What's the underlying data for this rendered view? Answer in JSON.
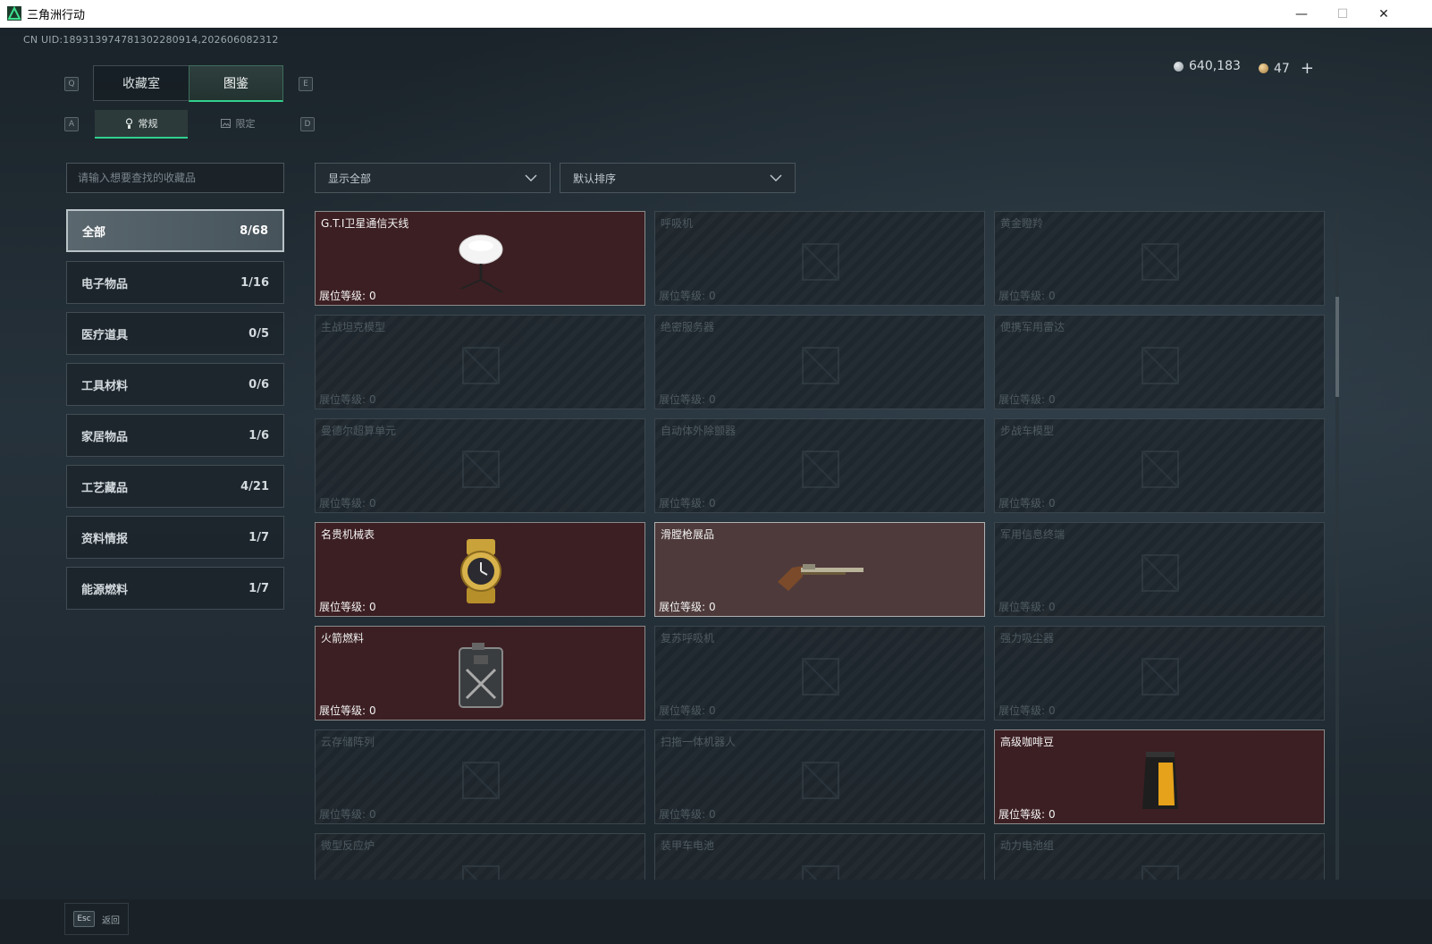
{
  "window": {
    "title": "三角洲行动",
    "minimize": "—",
    "maximize": "☐",
    "close": "✕"
  },
  "uid": "CN UID:189313974781302280914,202606082312",
  "currency": {
    "coins": "640,183",
    "gold": "47",
    "add": "+"
  },
  "tabs": [
    {
      "key": "Q"
    },
    {
      "label": "收藏室"
    },
    {
      "label": "图鉴"
    },
    {
      "key": "E"
    }
  ],
  "subtabs": {
    "left_key": "A",
    "right_key": "D",
    "items": [
      {
        "label": "常规"
      },
      {
        "label": "限定"
      }
    ]
  },
  "search": {
    "placeholder": "请输入想要查找的收藏品"
  },
  "filters": {
    "display": "显示全部",
    "sort": "默认排序"
  },
  "categories": [
    {
      "label": "全部",
      "count": "8/68"
    },
    {
      "label": "电子物品",
      "count": "1/16"
    },
    {
      "label": "医疗道具",
      "count": "0/5"
    },
    {
      "label": "工具材料",
      "count": "0/6"
    },
    {
      "label": "家居物品",
      "count": "1/6"
    },
    {
      "label": "工艺藏品",
      "count": "4/21"
    },
    {
      "label": "资料情报",
      "count": "1/7"
    },
    {
      "label": "能源燃料",
      "count": "1/7"
    }
  ],
  "level_label": "展位等级:",
  "items": [
    {
      "name": "G.T.I卫星通信天线",
      "level": "0",
      "owned": true,
      "icon": "satellite-antenna-icon"
    },
    {
      "name": "呼吸机",
      "level": "0",
      "owned": false,
      "icon": "ventilator-icon"
    },
    {
      "name": "黄金瞪羚",
      "level": "0",
      "owned": false,
      "icon": "golden-gazelle-icon"
    },
    {
      "name": "主战坦克模型",
      "level": "0",
      "owned": false,
      "icon": "tank-model-icon"
    },
    {
      "name": "绝密服务器",
      "level": "0",
      "owned": false,
      "icon": "server-icon"
    },
    {
      "name": "便携军用雷达",
      "level": "0",
      "owned": false,
      "icon": "radar-icon"
    },
    {
      "name": "曼德尔超算单元",
      "level": "0",
      "owned": false,
      "icon": "supercomputer-unit-icon"
    },
    {
      "name": "自动体外除颤器",
      "level": "0",
      "owned": false,
      "icon": "defibrillator-icon"
    },
    {
      "name": "步战车模型",
      "level": "0",
      "owned": false,
      "icon": "ifv-model-icon"
    },
    {
      "name": "名贵机械表",
      "level": "0",
      "owned": true,
      "icon": "watch-icon"
    },
    {
      "name": "滑膛枪展品",
      "level": "0",
      "owned": true,
      "highlight": true,
      "icon": "musket-icon"
    },
    {
      "name": "军用信息终端",
      "level": "0",
      "owned": false,
      "icon": "terminal-icon"
    },
    {
      "name": "火箭燃料",
      "level": "0",
      "owned": true,
      "icon": "fuel-can-icon"
    },
    {
      "name": "复苏呼吸机",
      "level": "0",
      "owned": false,
      "icon": "resuscitator-icon"
    },
    {
      "name": "强力吸尘器",
      "level": "0",
      "owned": false,
      "icon": "vacuum-icon"
    },
    {
      "name": "云存储阵列",
      "level": "0",
      "owned": false,
      "icon": "storage-array-icon"
    },
    {
      "name": "扫拖一体机器人",
      "level": "0",
      "owned": false,
      "icon": "robot-vacuum-icon"
    },
    {
      "name": "高级咖啡豆",
      "level": "0",
      "owned": true,
      "icon": "coffee-bag-icon"
    },
    {
      "name": "微型反应炉",
      "level": "",
      "owned": false,
      "icon": "reactor-icon"
    },
    {
      "name": "装甲车电池",
      "level": "",
      "owned": false,
      "icon": "battery-icon"
    },
    {
      "name": "动力电池组",
      "level": "",
      "owned": false,
      "icon": "battery-pack-icon"
    }
  ],
  "footer": {
    "key": "Esc",
    "label": "返回"
  }
}
